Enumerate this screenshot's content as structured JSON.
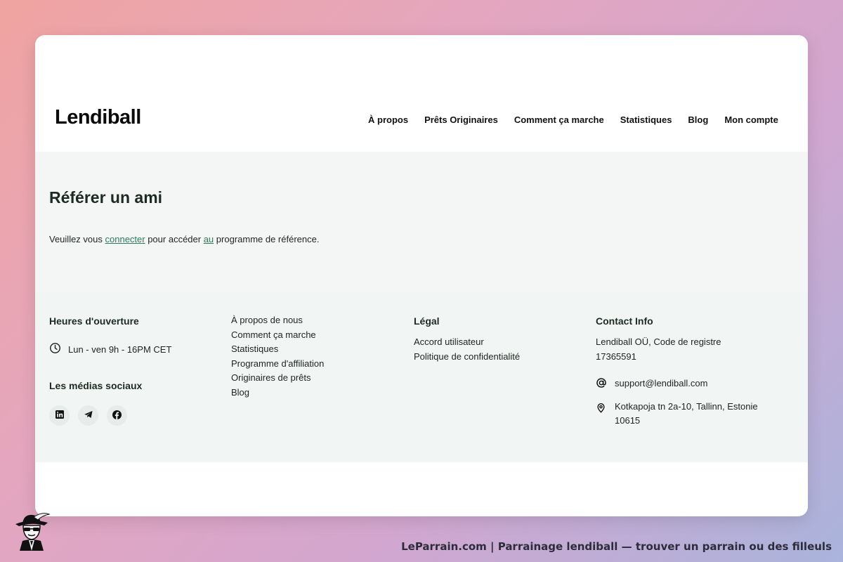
{
  "header": {
    "logo": "Lendiball",
    "nav": [
      "À propos",
      "Prêts Originaires",
      "Comment ça marche",
      "Statistiques",
      "Blog",
      "Mon compte"
    ]
  },
  "main": {
    "title": "Référer un ami",
    "intro": {
      "part1": "Veuillez vous ",
      "link1": "connecter",
      "part2": " pour accéder ",
      "link2": "au",
      "part3": " programme de référence."
    }
  },
  "footer": {
    "hours_title": "Heures d'ouverture",
    "hours": "Lun - ven 9h - 16PM CET",
    "social_title": "Les médias sociaux",
    "social_icons": [
      "linkedin-icon",
      "telegram-icon",
      "facebook-icon"
    ],
    "links": [
      "À propos de nous",
      "Comment ça marche",
      "Statistiques",
      "Programme d'affiliation",
      "Originaires de prêts",
      "Blog"
    ],
    "legal_title": "Légal",
    "legal_links": [
      "Accord utilisateur",
      "Politique de confidentialité"
    ],
    "contact_title": "Contact Info",
    "company": [
      "Lendiball OÜ, Code de registre",
      "17365591"
    ],
    "email": "support@lendiball.com",
    "address": [
      "Kotkapoja tn 2a-10, Tallinn, Estonie",
      "10615"
    ]
  },
  "credit": "LeParrain.com | Parrainage lendiball — trouver un parrain ou des filleuls",
  "colors": {
    "link": "#2d7b5c",
    "section_bg": "#f4f6f5",
    "footer_bg": "#f1f5f3",
    "text": "#1d2a24"
  }
}
